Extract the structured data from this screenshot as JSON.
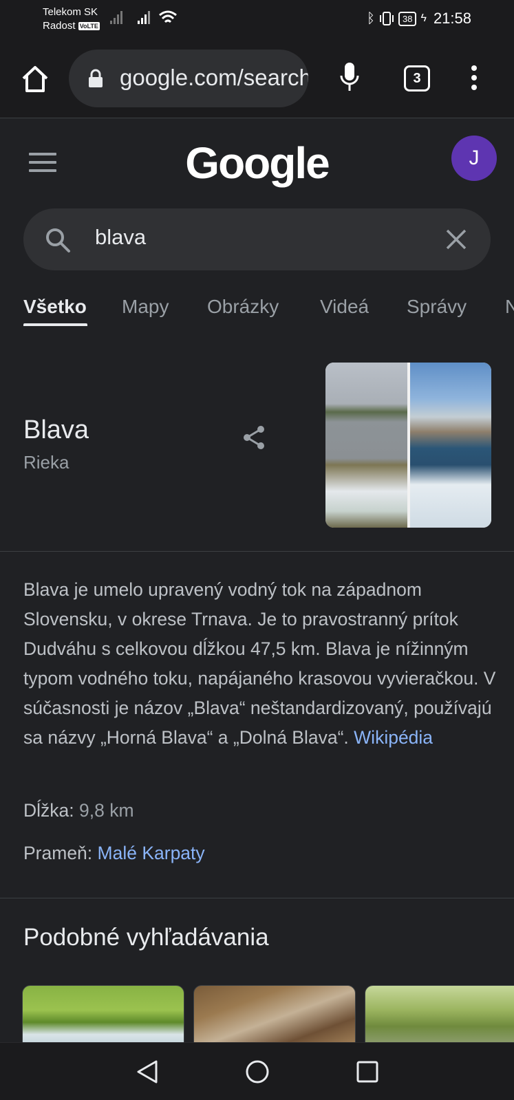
{
  "status_bar": {
    "carrier_1": "Telekom SK",
    "carrier_2": "Radost",
    "volte": "VoLTE",
    "battery": "38",
    "time": "21:58"
  },
  "browser": {
    "url": "google.com/search",
    "tab_count": "3"
  },
  "google": {
    "logo": "Google",
    "avatar_letter": "J"
  },
  "search": {
    "query": "blava"
  },
  "tabs": [
    {
      "label": "Všetko",
      "active": true
    },
    {
      "label": "Mapy"
    },
    {
      "label": "Obrázky"
    },
    {
      "label": "Videá"
    },
    {
      "label": "Správy"
    },
    {
      "label": "N"
    }
  ],
  "knowledge_panel": {
    "title": "Blava",
    "subtitle": "Rieka",
    "description": "Blava je umelo upravený vodný tok na západnom Slovensku, v okrese Trnava. Je to pravostranný prítok Dudváhu s celkovou dĺžkou 47,5 km. Blava je nížinným typom vodného toku, napájaného krasovou vyvieračkou. V súčasnosti je názov „Blava“ neštandardizovaný, používajú sa názvy „Horná Blava“ a „Dolná Blava“.",
    "source_link": "Wikipédia",
    "facts": [
      {
        "label": "Dĺžka:",
        "value": "9,8 km"
      },
      {
        "label": "Prameň:",
        "value": "Malé Karpaty"
      }
    ]
  },
  "related": {
    "title": "Podobné vyhľadávania"
  },
  "colors": {
    "background": "#202124",
    "link": "#8ab4f8",
    "avatar": "#5e35b1"
  }
}
